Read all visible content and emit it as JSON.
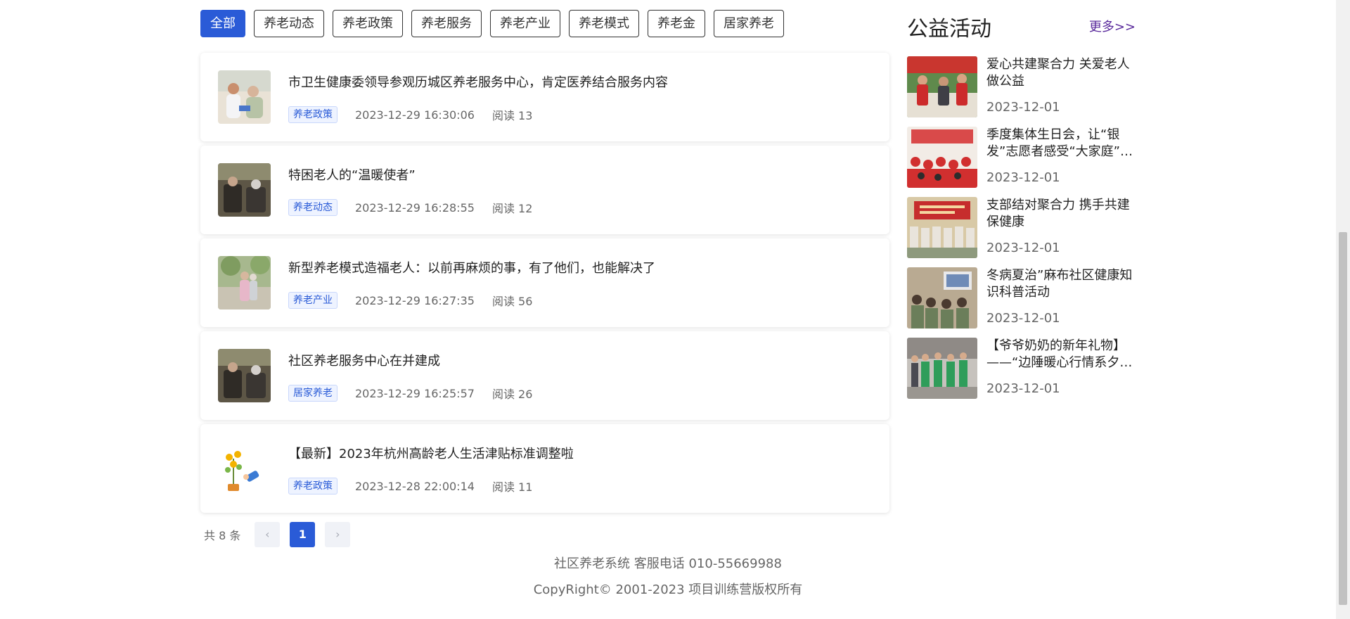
{
  "tabs": [
    {
      "label": "全部",
      "active": true
    },
    {
      "label": "养老动态"
    },
    {
      "label": "养老政策"
    },
    {
      "label": "养老服务"
    },
    {
      "label": "养老产业"
    },
    {
      "label": "养老模式"
    },
    {
      "label": "养老金"
    },
    {
      "label": "居家养老"
    }
  ],
  "news": [
    {
      "title": "市卫生健康委领导参观历城区养老服务中心，肯定医养结合服务内容",
      "category": "养老政策",
      "date": "2023-12-29 16:30:06",
      "reads": "阅读 13"
    },
    {
      "title": "特困老人的“温暖使者”",
      "category": "养老动态",
      "date": "2023-12-29 16:28:55",
      "reads": "阅读 12"
    },
    {
      "title": "新型养老模式造福老人：以前再麻烦的事，有了他们，也能解决了",
      "category": "养老产业",
      "date": "2023-12-29 16:27:35",
      "reads": "阅读 56"
    },
    {
      "title": "社区养老服务中心在并建成",
      "category": "居家养老",
      "date": "2023-12-29 16:25:57",
      "reads": "阅读 26"
    },
    {
      "title": "【最新】2023年杭州高龄老人生活津贴标准调整啦",
      "category": "养老政策",
      "date": "2023-12-28 22:00:14",
      "reads": "阅读 11"
    }
  ],
  "pager": {
    "total": "共 8 条",
    "prev": "‹",
    "page": "1",
    "next": "›"
  },
  "footer": {
    "line1": "社区养老系统 客服电话 010-55669988",
    "line2": "CopyRight© 2001-2023 项目训练营版权所有"
  },
  "sidebar": {
    "title": "公益活动",
    "more": "更多>>",
    "items": [
      {
        "title": "爱心共建聚合力 关爱老人做公益",
        "date": "2023-12-01"
      },
      {
        "title": "季度集体生日会，让“银发”志愿者感受“大家庭”的温暖",
        "date": "2023-12-01"
      },
      {
        "title": "支部结对聚合力 携手共建保健康",
        "date": "2023-12-01"
      },
      {
        "title": "冬病夏治”麻布社区健康知识科普活动",
        "date": "2023-12-01"
      },
      {
        "title": "【爷爷奶奶的新年礼物】——“边陲暖心行情系夕阳红”",
        "date": "2023-12-01"
      }
    ]
  },
  "colors": {
    "accent": "#2a5bd7",
    "more_link": "#5a2a9c"
  }
}
